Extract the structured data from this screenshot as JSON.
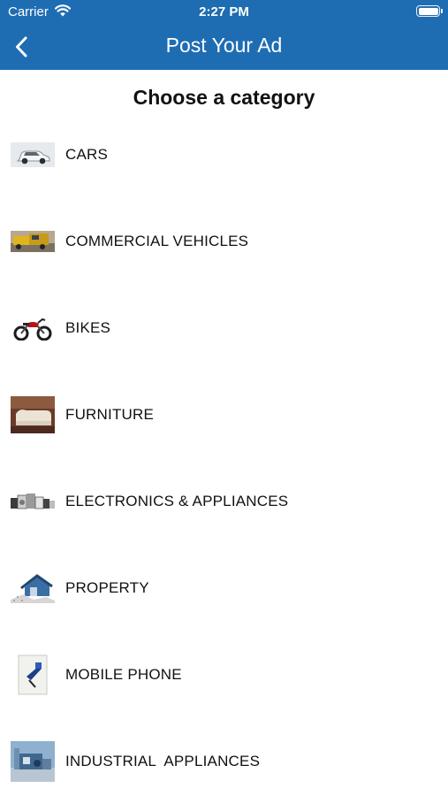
{
  "status_bar": {
    "carrier": "Carrier",
    "time": "2:27 PM"
  },
  "nav": {
    "title": "Post Your Ad"
  },
  "heading": "Choose a category",
  "colors": {
    "nav_bar": "#1e6db3",
    "text": "#111111"
  },
  "categories": [
    {
      "label": "CARS",
      "icon": "car-icon"
    },
    {
      "label": "COMMERCIAL VEHICLES",
      "icon": "truck-icon"
    },
    {
      "label": "BIKES",
      "icon": "motorbike-icon"
    },
    {
      "label": "FURNITURE",
      "icon": "sofa-icon"
    },
    {
      "label": "ELECTRONICS & APPLIANCES",
      "icon": "appliances-icon"
    },
    {
      "label": "PROPERTY",
      "icon": "house-icon"
    },
    {
      "label": "MOBILE PHONE",
      "icon": "mobile-phone-icon"
    },
    {
      "label": "INDUSTRIAL  APPLIANCES",
      "icon": "industrial-machine-icon"
    }
  ]
}
